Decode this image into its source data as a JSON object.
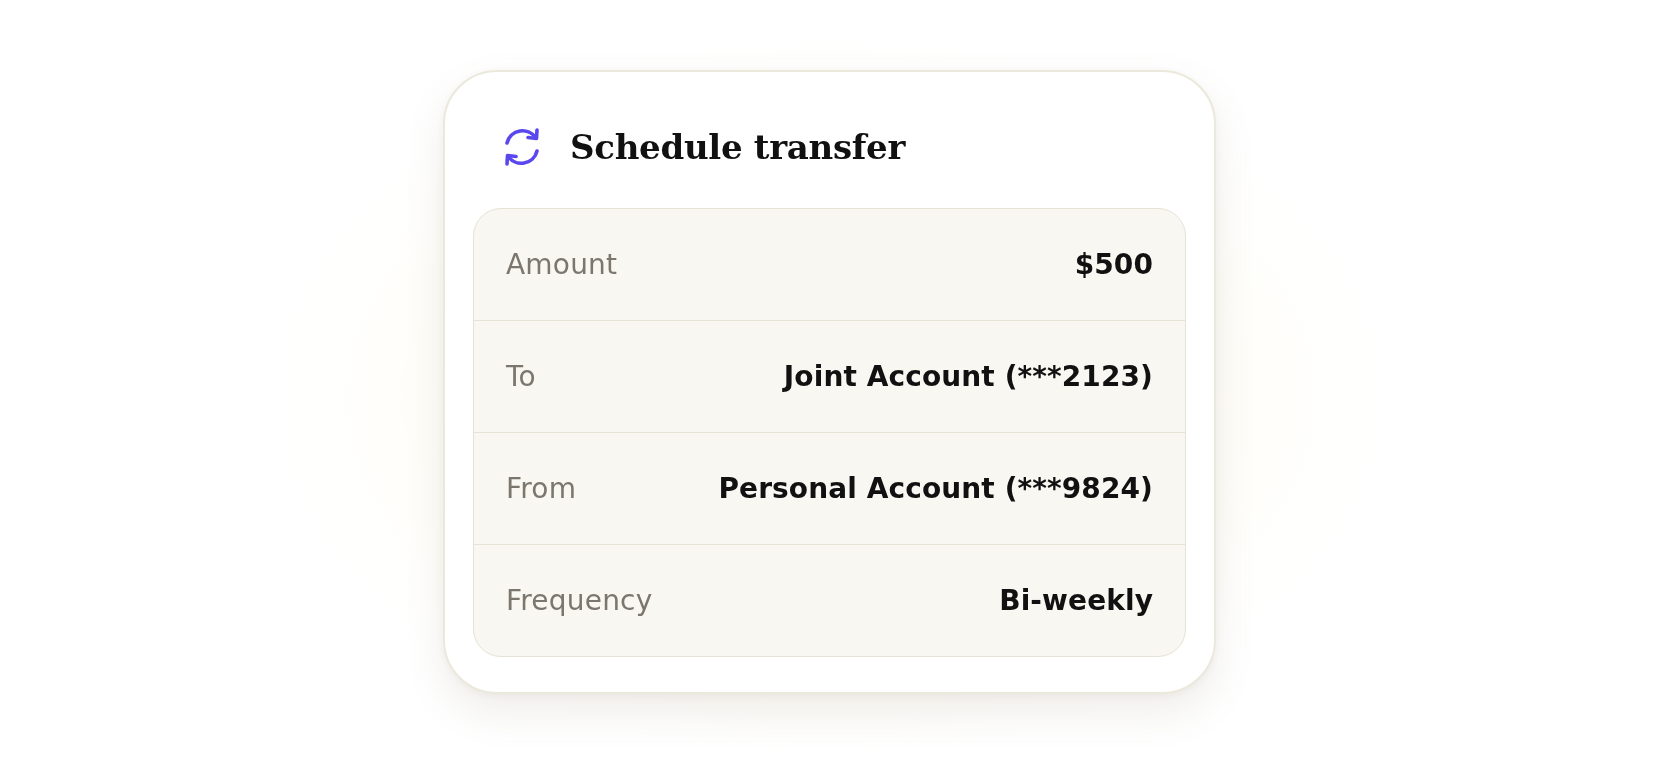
{
  "card": {
    "title": "Schedule transfer"
  },
  "details": [
    {
      "label": "Amount",
      "value": "$500"
    },
    {
      "label": "To",
      "value": "Joint Account (***2123)"
    },
    {
      "label": "From",
      "value": "Personal Account (***9824)"
    },
    {
      "label": "Frequency",
      "value": "Bi-weekly"
    }
  ]
}
